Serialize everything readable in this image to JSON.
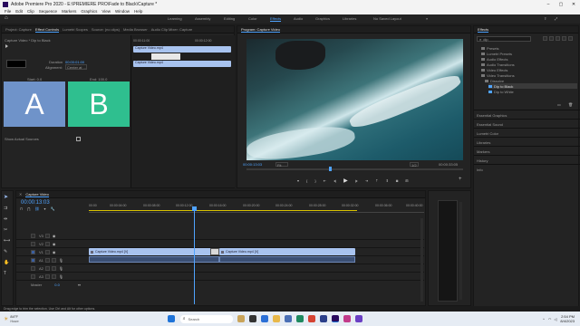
{
  "titlebar": {
    "title": "Adobe Premiere Pro 2020 - E:\\PREMIERE PRO\\Fade to Black\\Capture *"
  },
  "menu": [
    "File",
    "Edit",
    "Clip",
    "Sequence",
    "Markers",
    "Graphics",
    "View",
    "Window",
    "Help"
  ],
  "workspaces": [
    "Learning",
    "Assembly",
    "Editing",
    "Color",
    "Effects",
    "Audio",
    "Graphics",
    "Libraries",
    "No Saved Layout"
  ],
  "active_workspace": "Effects",
  "source_panel": {
    "tabs": [
      "Project: Capture",
      "Effect Controls",
      "Lumetri Scopes",
      "Source: (no clips)",
      "Media Browser",
      "Audio Clip Mixer: Capture"
    ],
    "active_tab": "Effect Controls",
    "header": "Capture Video * Dip to Black",
    "duration_label": "Duration",
    "duration_value": "00:00:01:00",
    "alignment_label": "Alignment:",
    "alignment_value": "Center at ...",
    "start_label": "Start: 0.0",
    "end_label": "End: 100.0",
    "a_label": "A",
    "b_label": "B",
    "show_actual_sources": "Show Actual Sources",
    "mini_timecodes": [
      "00:00:11:00",
      "00:00:12:00"
    ],
    "mini_clips": [
      "Capture Video.mp4",
      "Capture Video.mp4",
      "Capture Video.mp4"
    ]
  },
  "program_monitor": {
    "tab": "Program: Capture Video",
    "timecode": "00:00:13:03",
    "fit_label": "Fit",
    "full_label": "Full",
    "fraction": "1/2",
    "duration": "00:00:33:05"
  },
  "effects_panel": {
    "tab": "Effects",
    "search_value": "dip",
    "tree": [
      "Presets",
      "Lumetri Presets",
      "Audio Effects",
      "Audio Transitions",
      "Video Effects",
      "Video Transitions",
      "Dissolve",
      "Dip to Black",
      "Dip to White"
    ],
    "sections": [
      "Essential Graphics",
      "Essential Sound",
      "Lumetri Color",
      "Libraries",
      "Markers",
      "History",
      "Info"
    ]
  },
  "timeline": {
    "tab": "Capture Video",
    "timecode": "00:00:13:03",
    "ruler": [
      "00:00",
      "00:00:04:00",
      "00:00:08:00",
      "00:00:12:00",
      "00:00:16:00",
      "00:00:20:00",
      "00:00:24:00",
      "00:00:28:00",
      "00:00:32:00",
      "00:00:36:00",
      "00:00:40:00"
    ],
    "video_tracks": [
      "V3",
      "V2",
      "V1"
    ],
    "audio_tracks": [
      "A1",
      "A2",
      "A3"
    ],
    "master_label": "Master",
    "master_value": "0.0",
    "clip_left": "Capture Video.mp4 [V]",
    "clip_right": "Capture Video.mp4 [V]"
  },
  "status_bar": {
    "text": "Drag edge to trim the selection. Use Ctrl and Alt for other options."
  },
  "taskbar": {
    "weather_temp": "84°F",
    "weather_desc": "Haze",
    "search_placeholder": "Search",
    "time": "2:54 PM",
    "date": "8/4/2023"
  },
  "colors": {
    "accent": "#4fa3ff",
    "clip": "#a8c3ef",
    "a_thumb": "#6f93c9",
    "b_thumb": "#2fbf8f"
  }
}
